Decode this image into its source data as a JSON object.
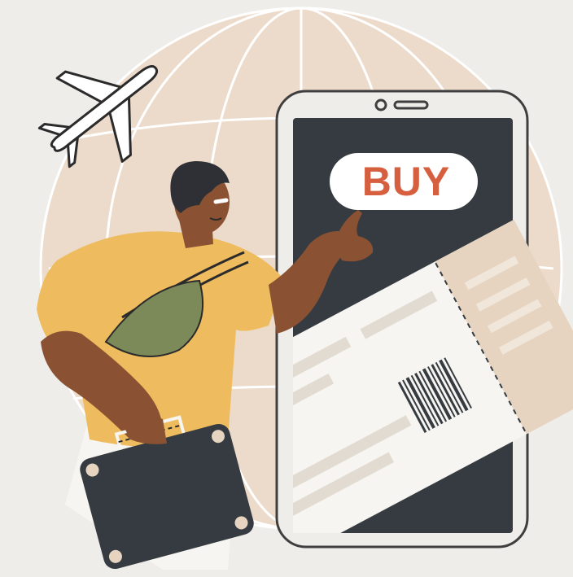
{
  "buy_button": {
    "label": "BUY"
  },
  "colors": {
    "background": "#eeede9",
    "globe_fill": "#ecdbca",
    "globe_lines": "#ffffff",
    "phone_screen": "#353b40",
    "phone_frame": "#3f3f3f",
    "buy_text": "#d65f3f",
    "buy_pill": "#ffffff",
    "shirt": "#eebb5f",
    "bag": "#7c8a5a",
    "skin": "#8a5232",
    "hair": "#2f3036",
    "ticket": "#f7f5f1",
    "ticket_stub": "#e6d4c0",
    "suitcase": "#353b40",
    "plane": "#ffffff"
  },
  "icons": [
    "airplane-icon",
    "globe-icon",
    "barcode-icon",
    "suitcase-icon"
  ]
}
